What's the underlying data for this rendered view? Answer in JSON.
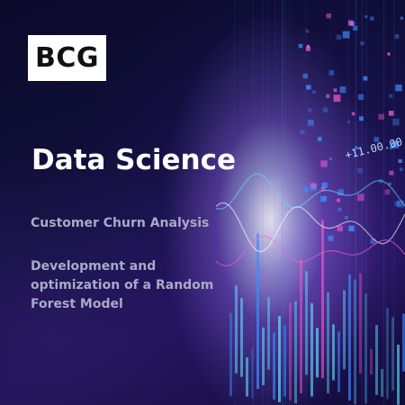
{
  "logo": {
    "text": "BCG"
  },
  "title": "Data Science",
  "subtitle": "Customer Churn Analysis",
  "description_lines": [
    "Development and",
    "optimization of a Random",
    "Forest Model"
  ],
  "background_code_text": "+11.00.00",
  "colors": {
    "background_dark": "#0a0a2e",
    "glow_center": "#ffffff",
    "accent_cyan": "#5fe0ff",
    "accent_blue": "#3d8cff",
    "accent_magenta": "#ff5fd6",
    "title_text": "#ffffff",
    "subtitle_text": "#a9a9c8",
    "logo_bg": "#ffffff",
    "logo_text": "#111111"
  }
}
